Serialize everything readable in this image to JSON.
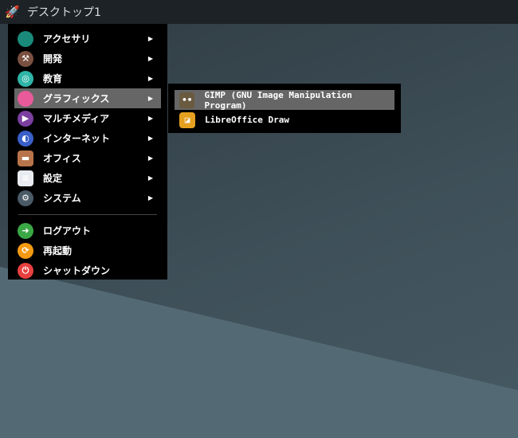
{
  "topbar": {
    "title": "デスクトップ1",
    "icon": "rocket-icon"
  },
  "main_menu": {
    "items": [
      {
        "label": "アクセサリ",
        "icon": "accessories-icon",
        "color": "#1a8a7a",
        "submenu": true
      },
      {
        "label": "開発",
        "icon": "hammer-icon",
        "color": "#7a5040",
        "submenu": true
      },
      {
        "label": "教育",
        "icon": "education-icon",
        "color": "#2fb5a8",
        "submenu": true
      },
      {
        "label": "グラフィックス",
        "icon": "graphics-icon",
        "color": "#e85a9a",
        "submenu": true,
        "highlighted": true
      },
      {
        "label": "マルチメディア",
        "icon": "multimedia-icon",
        "color": "#7b3fa0",
        "submenu": true
      },
      {
        "label": "インターネット",
        "icon": "internet-icon",
        "color": "#3a5fc8",
        "submenu": true
      },
      {
        "label": "オフィス",
        "icon": "briefcase-icon",
        "color": "#b8744a",
        "submenu": true
      },
      {
        "label": "設定",
        "icon": "settings-icon",
        "color": "#e8ecf0",
        "submenu": true
      },
      {
        "label": "システム",
        "icon": "gear-icon",
        "color": "#4a5a66",
        "submenu": true
      }
    ],
    "session": [
      {
        "label": "ログアウト",
        "icon": "logout-icon",
        "color": "#3aa845"
      },
      {
        "label": "再起動",
        "icon": "restart-icon",
        "color": "#f39a12"
      },
      {
        "label": "シャットダウン",
        "icon": "power-icon",
        "color": "#e84040"
      }
    ]
  },
  "submenu": {
    "items": [
      {
        "label": "GIMP (GNU Image Manipulation Program)",
        "icon": "gimp-icon",
        "highlighted": true
      },
      {
        "label": "LibreOffice Draw",
        "icon": "libreoffice-draw-icon"
      }
    ]
  },
  "arrow": "▶"
}
